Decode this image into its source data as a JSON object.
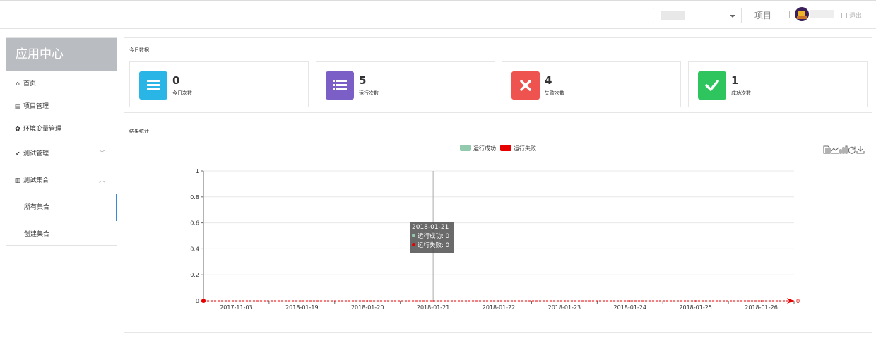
{
  "topbar": {
    "project_label": "项目",
    "logout_label": "退出"
  },
  "sidebar": {
    "title": "应用中心",
    "items": [
      {
        "label": "首页",
        "icon": "home-icon",
        "glyph": "⌂"
      },
      {
        "label": "项目管理",
        "icon": "file-icon",
        "glyph": "▤"
      },
      {
        "label": "环境变量管理",
        "icon": "gear-icon",
        "glyph": "✿"
      },
      {
        "label": "测试管理",
        "icon": "send-icon",
        "glyph": "➶",
        "chevron": "﹀"
      },
      {
        "label": "测试集合",
        "icon": "file-text-icon",
        "glyph": "▥",
        "chevron": "︿"
      }
    ],
    "sub_items": [
      {
        "label": "所有集合",
        "active": true
      },
      {
        "label": "创建集合",
        "active": false
      }
    ]
  },
  "today": {
    "title": "今日数据",
    "cards": [
      {
        "value": "0",
        "label": "今日次数",
        "color": "#29b6e6",
        "icon": "list-icon"
      },
      {
        "value": "5",
        "label": "运行次数",
        "color": "#7b5fc7",
        "icon": "list-detail-icon"
      },
      {
        "value": "4",
        "label": "失败次数",
        "color": "#ef5350",
        "icon": "close-icon"
      },
      {
        "value": "1",
        "label": "成功次数",
        "color": "#2ec55f",
        "icon": "check-icon"
      }
    ]
  },
  "results": {
    "title": "结果统计",
    "legend": [
      {
        "label": "运行成功",
        "color": "#93c9ad"
      },
      {
        "label": "运行失败",
        "color": "#e60000"
      }
    ],
    "toolbox": [
      "data-view-icon",
      "line-chart-icon",
      "bar-chart-icon",
      "refresh-icon",
      "download-icon"
    ],
    "tooltip": {
      "title": "2018-01-21",
      "rows": [
        {
          "label": "运行成功: 0",
          "color": "#93c9ad"
        },
        {
          "label": "运行失败: 0",
          "color": "#e60000"
        }
      ]
    }
  },
  "chart_data": {
    "type": "line",
    "x": [
      "2017-11-03",
      "2018-01-19",
      "2018-01-20",
      "2018-01-21",
      "2018-01-22",
      "2018-01-23",
      "2018-01-24",
      "2018-01-25",
      "2018-01-26"
    ],
    "series": [
      {
        "name": "运行成功",
        "values": [
          0,
          0,
          0,
          0,
          0,
          0,
          0,
          0,
          0
        ],
        "color": "#93c9ad"
      },
      {
        "name": "运行失败",
        "values": [
          0,
          0,
          0,
          0,
          0,
          0,
          0,
          0,
          0
        ],
        "color": "#e60000"
      }
    ],
    "yticks": [
      "0",
      "0.2",
      "0.4",
      "0.6",
      "0.8",
      "1"
    ],
    "ylim": [
      0,
      1
    ],
    "end_label": "0",
    "grid": true,
    "legend": "top-center"
  }
}
